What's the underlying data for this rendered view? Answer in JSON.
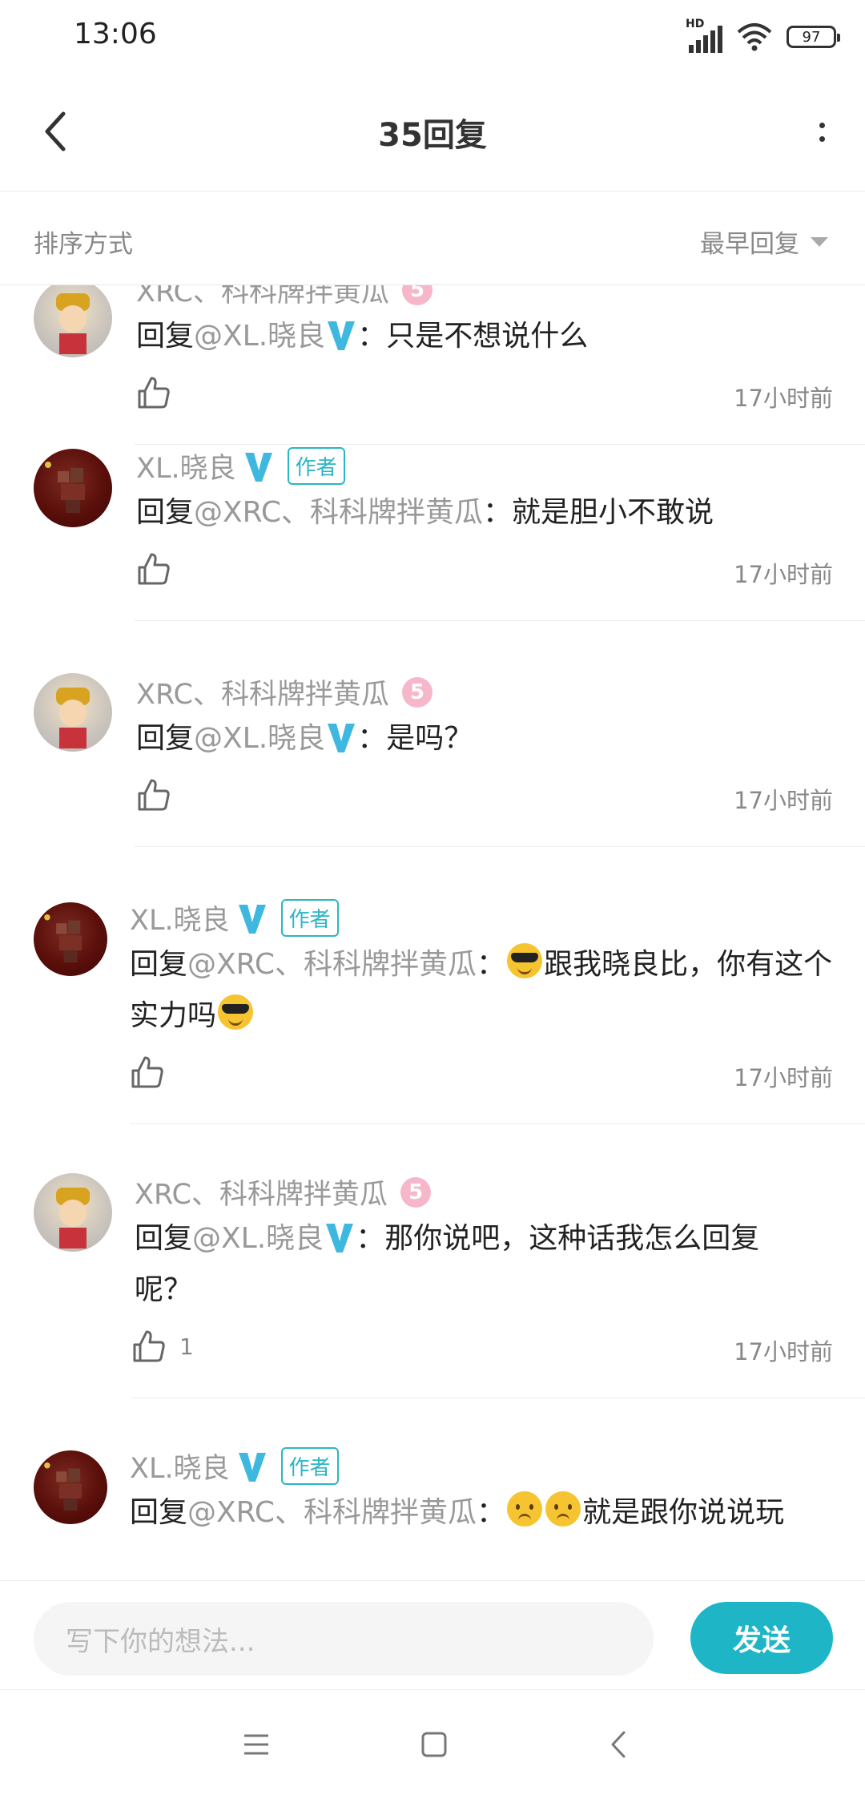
{
  "status_bar": {
    "time": "13:06",
    "network": "HD",
    "battery": "97"
  },
  "header": {
    "title": "35回复"
  },
  "sort": {
    "label": "排序方式",
    "selected": "最早回复"
  },
  "comments": [
    {
      "author": "XRC、科科牌拌黄瓜",
      "badge": "5",
      "reply_prefix": "回复",
      "mention": "@XL.晓良",
      "text_after": "：只是不想说什么",
      "likes": "",
      "time": "17小时前"
    },
    {
      "author": "XL.晓良",
      "tag": "作者",
      "reply_prefix": "回复",
      "mention": "@XRC、科科牌拌黄瓜",
      "text_after": "：就是胆小不敢说",
      "likes": "",
      "time": "17小时前"
    },
    {
      "author": "XRC、科科牌拌黄瓜",
      "badge": "5",
      "reply_prefix": "回复",
      "mention": "@XL.晓良",
      "text_after": "：是吗？",
      "likes": "",
      "time": "17小时前"
    },
    {
      "author": "XL.晓良",
      "tag": "作者",
      "reply_prefix": "回复",
      "mention": "@XRC、科科牌拌黄瓜",
      "text_after": "：",
      "text_mid": "跟我晓良比，你有这个实力吗",
      "likes": "",
      "time": "17小时前"
    },
    {
      "author": "XRC、科科牌拌黄瓜",
      "badge": "5",
      "reply_prefix": "回复",
      "mention": "@XL.晓良",
      "text_after": "：那你说吧，这种话我怎么回复呢？",
      "likes": "1",
      "time": "17小时前"
    },
    {
      "author": "XL.晓良",
      "tag": "作者",
      "reply_prefix": "回复",
      "mention": "@XRC、科科牌拌黄瓜",
      "text_after": "：",
      "text_mid": "就是跟你说说玩",
      "likes": "",
      "time": ""
    }
  ],
  "composer": {
    "placeholder": "写下你的想法...",
    "send_label": "发送"
  },
  "icons": {
    "back": "back-arrow-icon",
    "more": "more-vertical-icon",
    "verified": "verified-v-icon",
    "like": "thumbs-up-icon",
    "menu": "menu-icon",
    "home": "home-square-icon",
    "nav_back": "nav-back-icon"
  },
  "colors": {
    "accent": "#1eb6c7",
    "verified": "#3fb8e0",
    "badge_pink": "#f6b7cb"
  }
}
